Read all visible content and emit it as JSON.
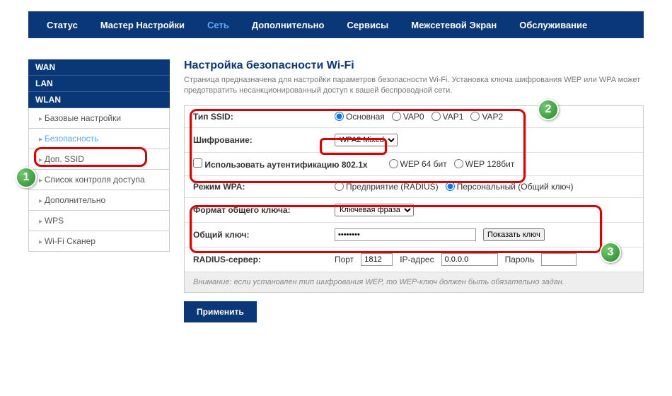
{
  "nav": {
    "items": [
      "Статус",
      "Мастер Настройки",
      "Сеть",
      "Дополнительно",
      "Сервисы",
      "Межсетевой Экран",
      "Обслуживание"
    ],
    "active_index": 2
  },
  "sidebar": {
    "sections": [
      {
        "header": "WAN",
        "items": []
      },
      {
        "header": "LAN",
        "items": []
      },
      {
        "header": "WLAN",
        "items": [
          "Базовые настройки",
          "Безопасность",
          "Доп. SSID",
          "Список контроля доступа",
          "Дополнительно",
          "WPS",
          "Wi-Fi Сканер"
        ],
        "active_index": 1
      }
    ]
  },
  "page": {
    "title": "Настройка безопасности Wi-Fi",
    "desc": "Страница предназначена для настройки параметров безопасности Wi-Fi. Установка ключа шифрования WEP или WPA может предотвратить несанкционированный доступ к вашей беспроводной сети."
  },
  "form": {
    "ssid_label": "Тип SSID:",
    "ssid_options": [
      "Основная",
      "VAP0",
      "VAP1",
      "VAP2"
    ],
    "ssid_selected": 0,
    "enc_label": "Шифрование:",
    "enc_value": "WPA2 Mixed",
    "auth_label": "Использовать аутентификацию 802.1x",
    "wep_opts": [
      "WEP 64 бит",
      "WEP 128бит"
    ],
    "wpa_mode_label": "Режим WPA:",
    "wpa_mode_opts": [
      "Предприятие (RADIUS)",
      "Персональный (Общий ключ)"
    ],
    "wpa_mode_selected": 1,
    "key_fmt_label": "Формат общего ключа:",
    "key_fmt_value": "Ключевая фраза",
    "key_label": "Общий ключ:",
    "key_value": "********",
    "show_key": "Показать ключ",
    "radius_label": "RADIUS-сервер:",
    "radius_port_lbl": "Порт",
    "radius_port": "1812",
    "radius_ip_lbl": "IP-адрес",
    "radius_ip": "0.0.0.0",
    "radius_pwd_lbl": "Пароль",
    "note": "Внимание: если установлен тип шифрования WEP, то WEP-ключ должен быть обязательно задан.",
    "apply": "Применить"
  },
  "badges": [
    "1",
    "2",
    "3"
  ]
}
